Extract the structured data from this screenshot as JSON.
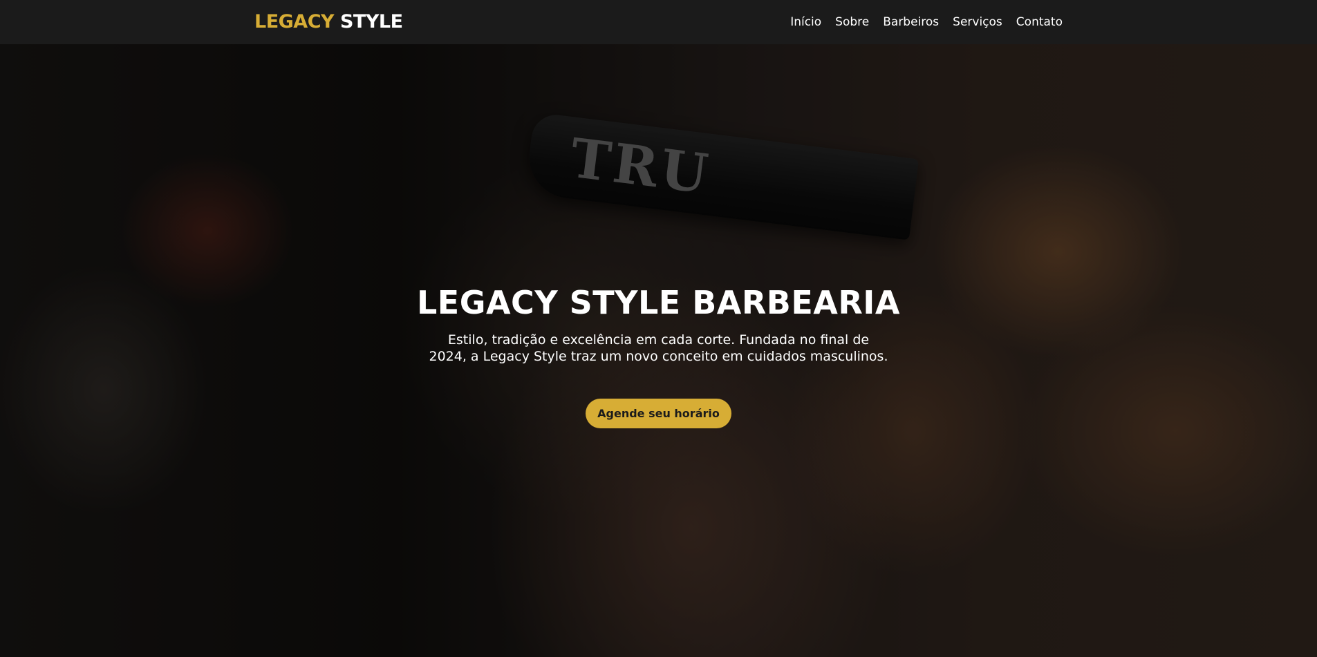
{
  "brand": {
    "logo_part1": "LEGACY",
    "logo_part2": "STYLE",
    "accent_color": "#d7ad35"
  },
  "nav": {
    "items": [
      "Início",
      "Sobre",
      "Barbeiros",
      "Serviços",
      "Contato"
    ]
  },
  "hero": {
    "title": "LEGACY STYLE BARBEARIA",
    "subtitle": "Estilo, tradição e excelência em cada corte. Fundada no final de 2024, a Legacy Style traz um novo conceito em cuidados masculinos.",
    "cta_label": "Agende seu horário",
    "background_image_text": "TRU"
  }
}
